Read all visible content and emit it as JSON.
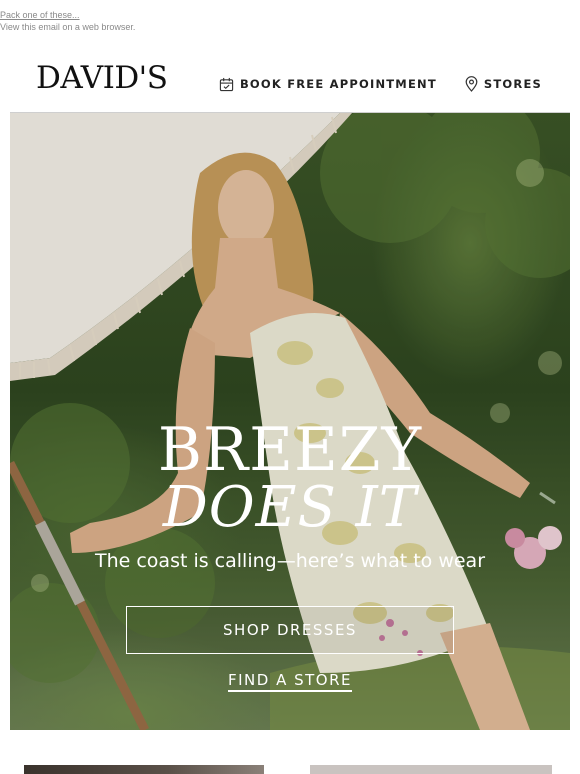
{
  "preheader": {
    "line1": "Pack one of these...",
    "line2": "View this email on a web browser."
  },
  "header": {
    "logo": "DAVID'S",
    "nav": [
      {
        "label": "BOOK FREE APPOINTMENT",
        "icon": "calendar-check-icon"
      },
      {
        "label": "STORES",
        "icon": "map-pin-icon"
      }
    ]
  },
  "hero": {
    "title_line1": "BREEZY",
    "title_line2": "DOES IT",
    "subtitle": "The coast is calling—here’s what to wear",
    "cta_primary": "SHOP DRESSES",
    "cta_secondary": "FIND A STORE"
  }
}
